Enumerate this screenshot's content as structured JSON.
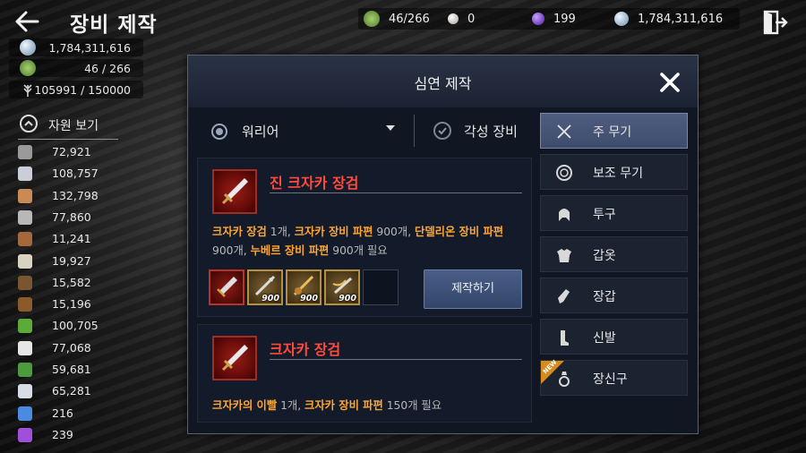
{
  "header": {
    "title": "장비 제작",
    "currencies": [
      {
        "icon": "green-gem-icon",
        "value": "46/266",
        "color": "#7fae4c"
      },
      {
        "icon": "pearl-icon",
        "value": "0",
        "color": "#d8d0c8"
      },
      {
        "icon": "purple-orb-icon",
        "value": "199",
        "color": "#7b3ad8"
      },
      {
        "icon": "silver-coin-icon",
        "value": "1,784,311,616",
        "color": "#b8c8d8"
      }
    ]
  },
  "wallet": {
    "silver": "1,784,311,616",
    "energy": "46 / 266",
    "weight": "105991 / 150000"
  },
  "resources": {
    "toggle_label": "자원 보기",
    "items": [
      {
        "icon": "ore-icon",
        "value": "72,921",
        "color": "#9a9a9a"
      },
      {
        "icon": "stone-icon",
        "value": "108,757",
        "color": "#c8cfd8"
      },
      {
        "icon": "leather-icon",
        "value": "132,798",
        "color": "#c98a55"
      },
      {
        "icon": "feather-icon",
        "value": "77,860",
        "color": "#b8b8b8"
      },
      {
        "icon": "wood-icon",
        "value": "11,241",
        "color": "#a5683a"
      },
      {
        "icon": "bone-icon",
        "value": "19,927",
        "color": "#d8d2c2"
      },
      {
        "icon": "plank-icon",
        "value": "15,582",
        "color": "#7a5532"
      },
      {
        "icon": "log-icon",
        "value": "15,196",
        "color": "#8a5a2a"
      },
      {
        "icon": "herb-icon",
        "value": "100,705",
        "color": "#5caa3a"
      },
      {
        "icon": "cotton-icon",
        "value": "77,068",
        "color": "#e6e6e6"
      },
      {
        "icon": "leaf-icon",
        "value": "59,681",
        "color": "#4e9a3e"
      },
      {
        "icon": "crystal-icon",
        "value": "65,281",
        "color": "#d8dce6"
      },
      {
        "icon": "blue-shard-icon",
        "value": "216",
        "color": "#4a8ae0"
      },
      {
        "icon": "purple-stone-icon",
        "value": "239",
        "color": "#a050d8"
      }
    ]
  },
  "dialog": {
    "title": "심연 제작",
    "class_select": "워리어",
    "awakening_label": "각성 장비",
    "recipes": [
      {
        "name": "진 크자카 장검",
        "requirement_parts": [
          {
            "text": "크자카 장검",
            "hl": true
          },
          {
            "text": " 1개, ",
            "hl": false
          },
          {
            "text": "크자카 장비 파편",
            "hl": true
          },
          {
            "text": " 900개, ",
            "hl": false
          },
          {
            "text": "단델리온 장비 파편",
            "hl": true
          },
          {
            "text": " 900개, ",
            "hl": false
          },
          {
            "text": "누베르 장비 파편",
            "hl": true
          },
          {
            "text": " 900개 필요",
            "hl": false
          }
        ],
        "materials": [
          {
            "type": "red",
            "qty": ""
          },
          {
            "type": "gold",
            "qty": "900"
          },
          {
            "type": "gold",
            "qty": "900"
          },
          {
            "type": "gold",
            "qty": "900"
          }
        ],
        "craft_label": "제작하기"
      },
      {
        "name": "크자카 장검",
        "requirement_parts": [
          {
            "text": "크자카의 이빨",
            "hl": true
          },
          {
            "text": " 1개, ",
            "hl": false
          },
          {
            "text": "크자카 장비 파편",
            "hl": true
          },
          {
            "text": " 150개 필요",
            "hl": false
          }
        ]
      }
    ],
    "categories": [
      {
        "label": "주 무기",
        "icon": "crossed-swords-icon",
        "active": true
      },
      {
        "label": "보조 무기",
        "icon": "shield-ring-icon",
        "active": false
      },
      {
        "label": "투구",
        "icon": "helmet-icon",
        "active": false
      },
      {
        "label": "갑옷",
        "icon": "armor-icon",
        "active": false
      },
      {
        "label": "장갑",
        "icon": "glove-icon",
        "active": false
      },
      {
        "label": "신발",
        "icon": "boot-icon",
        "active": false
      },
      {
        "label": "장신구",
        "icon": "ring-icon",
        "active": false,
        "badge": "NEW"
      }
    ]
  }
}
